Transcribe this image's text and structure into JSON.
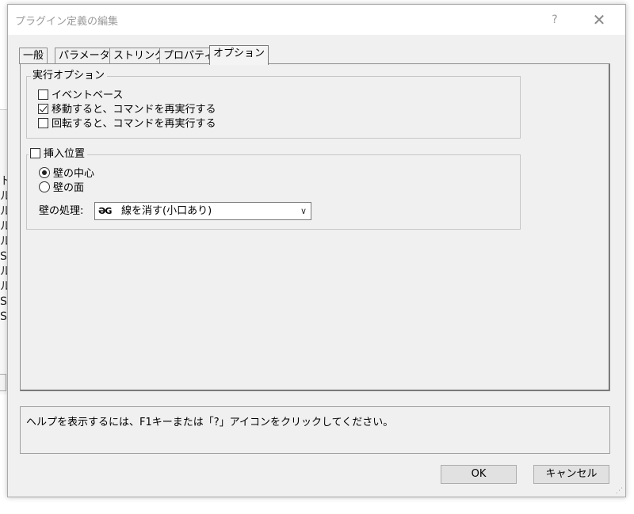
{
  "window": {
    "title": "プラグイン定義の編集",
    "help_glyph": "?",
    "close_glyph": "✕"
  },
  "background_window": {
    "line_glyphs": [
      "ト",
      "ル",
      "ル",
      "ル",
      "ル",
      "S",
      "ル",
      "ル",
      "S",
      "S"
    ]
  },
  "tabs": [
    {
      "label": "一般",
      "active": false
    },
    {
      "label": "パラメータ",
      "active": false
    },
    {
      "label": "ストリング",
      "active": false
    },
    {
      "label": "プロパティ",
      "active": false
    },
    {
      "label": "オプション",
      "active": true
    }
  ],
  "exec_options": {
    "title": "実行オプション",
    "items": [
      {
        "label": "イベントベース",
        "checked": false
      },
      {
        "label": "移動すると、コマンドを再実行する",
        "checked": true
      },
      {
        "label": "回転すると、コマンドを再実行する",
        "checked": false
      }
    ]
  },
  "insert_position": {
    "title": "挿入位置",
    "checked": false,
    "radios": [
      {
        "label": "壁の中心",
        "selected": true
      },
      {
        "label": "壁の面",
        "selected": false
      }
    ],
    "wall_process_label": "壁の処理:",
    "wall_process_icon_text": "ƏG",
    "wall_process_value": "線を消す(小口あり)"
  },
  "help_text": "ヘルプを表示するには、F1キーまたは「?」アイコンをクリックしてください。",
  "buttons": {
    "ok": "OK",
    "cancel": "キャンセル"
  }
}
